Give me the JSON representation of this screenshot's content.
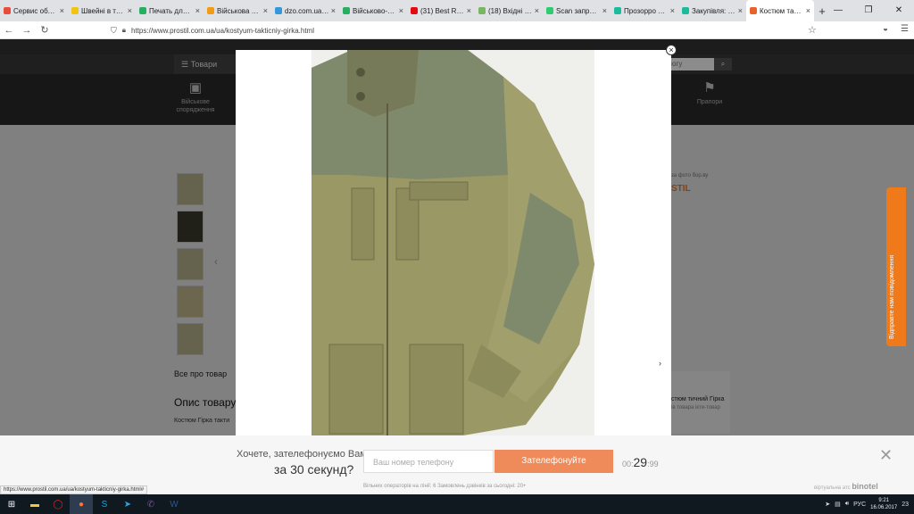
{
  "browser": {
    "tabs": [
      {
        "label": "Сервис объявлени",
        "color": "#e74c3c"
      },
      {
        "label": "Швейні в тенде",
        "color": "#f1c40f"
      },
      {
        "label": "Печать для Пр",
        "color": "#27ae60"
      },
      {
        "label": "Військова апра",
        "color": "#f39c12"
      },
      {
        "label": "dzo.com.ua/ten",
        "color": "#3498db"
      },
      {
        "label": "Військово-такт",
        "color": "#27ae60"
      },
      {
        "label": "(31) Best Rock G",
        "color": "#e50914"
      },
      {
        "label": "(18) Вхідні - m",
        "color": "#7bb661"
      },
      {
        "label": "Scan запрос КП",
        "color": "#2ecc71"
      },
      {
        "label": "Прозорро закуп",
        "color": "#1abc9c"
      },
      {
        "label": "Закупівля: Пр",
        "color": "#1abc9c"
      },
      {
        "label": "Костюм тактич",
        "color": "#e8632b"
      }
    ],
    "new_tab": "+",
    "url": "https://www.prostil.com.ua/ua/kostyum-takticniy-girka.html",
    "status_url": "https://www.prostil.com.ua/ua/kostyum-takticniy-girka.html#"
  },
  "site": {
    "goods_label": "Товари",
    "search_placeholder": "ологу",
    "categories": [
      {
        "label": "Військове спорядження",
        "icon": "backpack-icon"
      },
      {
        "label": "Прапори",
        "icon": "flag-icon"
      }
    ],
    "all_about": "Все про товар",
    "desc_title": "Опис товару",
    "desc_text": "Костюм Гірка такти",
    "seller_note": "за фото бор.ву",
    "seller_logo": "STIL",
    "side_card_title": "стюм тичний Гірка",
    "side_card_sub": "ів товара ікти-товар"
  },
  "feedback_tab": {
    "label": "Відправте нам повідомлення"
  },
  "callback": {
    "question_line1": "Хочете, зателефонуємо Вам",
    "question_line2": "за 30 секунд?",
    "phone_placeholder": "Ваш номер телефону",
    "button_label": "Зателефонуйте",
    "timer_prefix": "00:",
    "timer_seconds": "29",
    "timer_suffix": ":99",
    "footer": "Вільних операторів на лінії: 6    Замовлень дзвінків за сьогодні: 20+",
    "brand_prefix": "віртуальна атс",
    "brand_name": "binotel"
  },
  "taskbar": {
    "lang": "РУС",
    "time": "9:21",
    "date": "16.06.2017",
    "notif": "23"
  }
}
